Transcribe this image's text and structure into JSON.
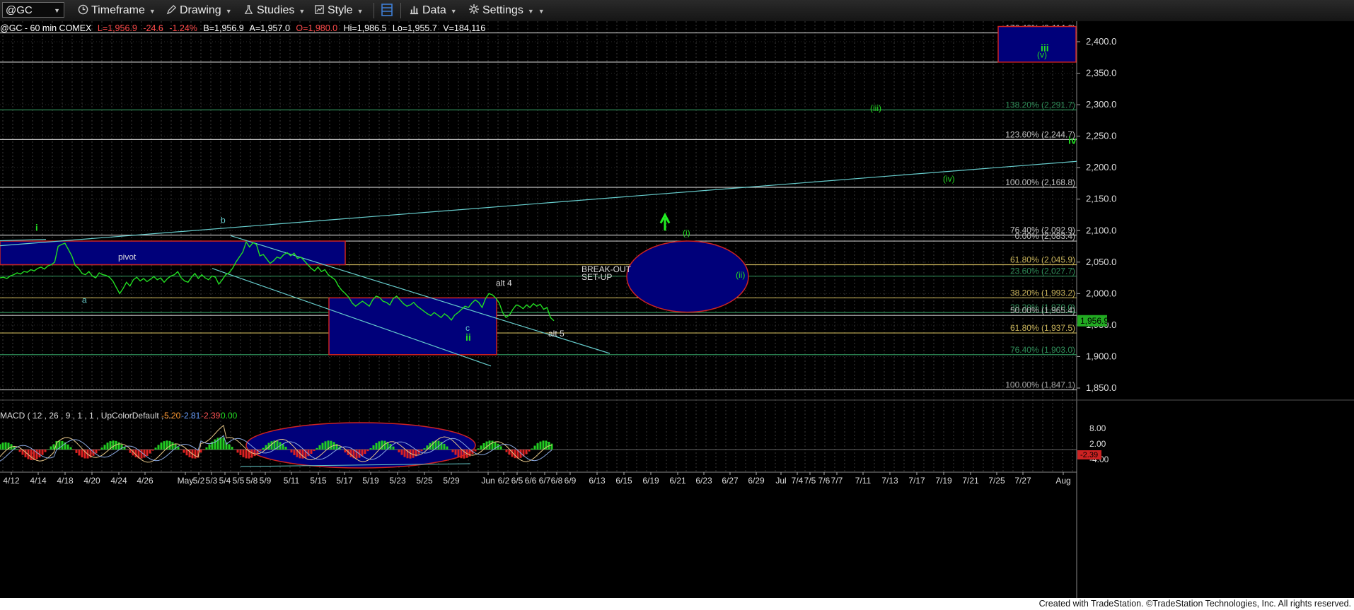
{
  "toolbar": {
    "symbol": "@GC",
    "timeframe": "Timeframe",
    "drawing": "Drawing",
    "studies": "Studies",
    "style": "Style",
    "data": "Data",
    "settings": "Settings"
  },
  "info": {
    "title": "@GC - 60 min  COMEX",
    "last": "L=1,956.9",
    "change": "-24.6",
    "pct": "-1.24%",
    "bid": "B=1,956.9",
    "ask": "A=1,957.0",
    "open": "O=1,980.0",
    "high": "Hi=1,986.5",
    "low": "Lo=1,955.7",
    "volume": "V=184,116"
  },
  "chart_data": {
    "type": "line",
    "symbol": "@GC",
    "interval": "60 min",
    "y_ticks": [
      "2,400.0",
      "2,350.0",
      "2,300.0",
      "2,250.0",
      "2,200.0",
      "2,150.0",
      "2,100.0",
      "2,050.0",
      "2,000.0",
      "1,950.0",
      "1,900.0",
      "1,850.0"
    ],
    "x_ticks": [
      "4/12",
      "4/14",
      "4/18",
      "4/20",
      "4/24",
      "4/26",
      "May",
      "5/2",
      "5/3",
      "5/4",
      "5/5",
      "5/8",
      "5/9",
      "5/11",
      "5/15",
      "5/17",
      "5/19",
      "5/23",
      "5/25",
      "5/29",
      "Jun",
      "6/2",
      "6/5",
      "6/6",
      "6/7",
      "6/8",
      "6/9",
      "6/13",
      "6/15",
      "6/19",
      "6/21",
      "6/23",
      "6/27",
      "6/29",
      "Jul",
      "7/4",
      "7/5",
      "7/6",
      "7/7",
      "7/11",
      "7/13",
      "7/17",
      "7/19",
      "7/21",
      "7/25",
      "7/27",
      "Aug"
    ],
    "last_price": "1,956.9",
    "price_path": [
      2025,
      2026,
      2024,
      2028,
      2030,
      2033,
      2031,
      2035,
      2034,
      2038,
      2036,
      2040,
      2042,
      2039,
      2044,
      2046,
      2050,
      2075,
      2078,
      2080,
      2070,
      2060,
      2045,
      2040,
      2032,
      2030,
      2035,
      2028,
      2025,
      2033,
      2030,
      2029,
      2026,
      2020,
      2010,
      2000,
      2008,
      2018,
      2012,
      2022,
      2026,
      2020,
      2024,
      2019,
      2023,
      2027,
      2022,
      2025,
      2018,
      2024,
      2028,
      2030,
      2035,
      2025,
      2020,
      2018,
      2026,
      2032,
      2024,
      2030,
      2025,
      2022,
      2028,
      2026,
      2015,
      2022,
      2030,
      2033,
      2040,
      2050,
      2058,
      2066,
      2082,
      2074,
      2081,
      2078,
      2060,
      2062,
      2055,
      2048,
      2052,
      2058,
      2056,
      2062,
      2065,
      2060,
      2064,
      2056,
      2058,
      2052,
      2046,
      2040,
      2036,
      2042,
      2035,
      2038,
      2030,
      2026,
      2022,
      2012,
      2005,
      2000,
      1994,
      1985,
      1980,
      1984,
      1988,
      1984,
      1980,
      1990,
      1996,
      1994,
      1988,
      1986,
      1982,
      1992,
      1996,
      1990,
      1984,
      1980,
      1982,
      1986,
      1980,
      1976,
      1972,
      1968,
      1965,
      1970,
      1966,
      1962,
      1968,
      1964,
      1958,
      1966,
      1970,
      1975,
      1980,
      1978,
      1985,
      1990,
      1986,
      1978,
      1992,
      2000,
      1998,
      1993,
      1985,
      1970,
      1962,
      1966,
      1975,
      1982,
      1980,
      1976,
      1982,
      1978,
      1984,
      1980,
      1983,
      1975,
      1978,
      1962,
      1956.9
    ],
    "fib_levels": [
      {
        "label": "176.40% (2,414.0)",
        "value": 2414.0,
        "color": "#ffffff"
      },
      {
        "label": "161.80% (2,367.6)",
        "value": 2367.6,
        "color": "#ffffff"
      },
      {
        "label": "138.20% (2,291.7)",
        "value": 2291.7,
        "color": "#2e8b57"
      },
      {
        "label": "123.60% (2,244.7)",
        "value": 2244.7,
        "color": "#ffffff"
      },
      {
        "label": "100.00% (2,168.8)",
        "value": 2168.8,
        "color": "#ffffff"
      },
      {
        "label": "76.40% (2,092.9)",
        "value": 2092.9,
        "color": "#ffffff"
      },
      {
        "label": "0.00% (2,083.4)",
        "value": 2083.4,
        "color": "#ffffff"
      },
      {
        "label": "61.80% (2,045.9)",
        "value": 2045.9,
        "color": "#c8b35a"
      },
      {
        "label": "23.60% (2,027.7)",
        "value": 2027.7,
        "color": "#2e8b57"
      },
      {
        "label": "38.20% (1,993.2)",
        "value": 1993.2,
        "color": "#c8b35a"
      },
      {
        "label": "38.20% (1,970.0)",
        "value": 1970.0,
        "color": "#2e8b57"
      },
      {
        "label": "50.00% (1,965.4)",
        "value": 1965.4,
        "color": "#ffffff"
      },
      {
        "label": "61.80% (1,937.5)",
        "value": 1937.5,
        "color": "#c8b35a"
      },
      {
        "label": "76.40% (1,903.0)",
        "value": 1903.0,
        "color": "#2e8b57"
      },
      {
        "label": "100.00% (1,847.1)",
        "value": 1847.1,
        "color": "#ffffff"
      }
    ],
    "annotations": {
      "wave_i": "i",
      "wave_a": "a",
      "wave_b": "b",
      "wave_c": "c",
      "wave_ii": "ii",
      "pivot": "pivot",
      "alt4": "alt 4",
      "alt5": "alt 5",
      "sub_i": "(i)",
      "sub_ii": "(ii)",
      "sub_iii": "(iii)",
      "sub_iv": "(iv)",
      "sub_v": "(v)",
      "target_iii": "iii",
      "target_iv": "iv",
      "breakout_line1": "BREAK-OUT",
      "breakout_line2": "SET-UP"
    },
    "macd": {
      "label": "MACD ( 12 , 26 , 9 , 1 , 1 , UpColorDefault , ...",
      "values": [
        "-5.20",
        "-2.81",
        "-2.39",
        "0.00"
      ],
      "y_ticks": [
        "8.00",
        "2.00",
        "-4.00"
      ],
      "last": "-2.39"
    },
    "colors": {
      "price": "#22dd22",
      "box": "#00007a",
      "box_border": "#cc2222",
      "trend": "#66cccc",
      "grid": "#444444"
    }
  },
  "footer": {
    "credit": "Created with TradeStation. ©TradeStation Technologies, Inc. All rights reserved."
  }
}
